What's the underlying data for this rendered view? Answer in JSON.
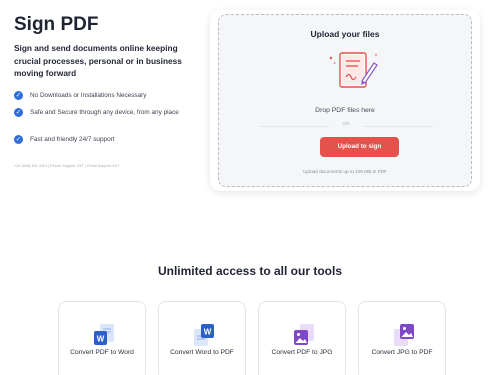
{
  "hero": {
    "title": "Sign PDF",
    "description": "Sign and send documents online keeping crucial processes, personal or in business moving forward"
  },
  "features": [
    {
      "text": "No Downloads or Installations Necessary",
      "icon": "check-icon"
    },
    {
      "text": "Safe and Secure through any device, from any place",
      "icon": "check-icon"
    },
    {
      "text": "Fast and friendly 24/7 support",
      "icon": "check-icon"
    }
  ],
  "contact": "+44 (808) 501 3114  |  Phone Support 24/7  |  Email Support 24/7",
  "upload": {
    "title": "Upload your files",
    "drop_text": "Drop PDF files here",
    "or_text": "OR",
    "button_label": "Upload to sign",
    "limit_text": "Upload documents up to 100 MB in PDF"
  },
  "tools": {
    "heading": "Unlimited access to all our tools",
    "items": [
      {
        "label": "Convert PDF to Word",
        "icon": "word-doc-icon"
      },
      {
        "label": "Convert Word to PDF",
        "icon": "word-to-pdf-icon"
      },
      {
        "label": "Convert PDF to JPG",
        "icon": "jpg-image-icon"
      },
      {
        "label": "Convert JPG to PDF",
        "icon": "jpg-to-pdf-icon"
      }
    ]
  },
  "colors": {
    "accent": "#e5514b",
    "check": "#2f6ed8",
    "word": "#2b5fc9",
    "image": "#7e48c8"
  }
}
